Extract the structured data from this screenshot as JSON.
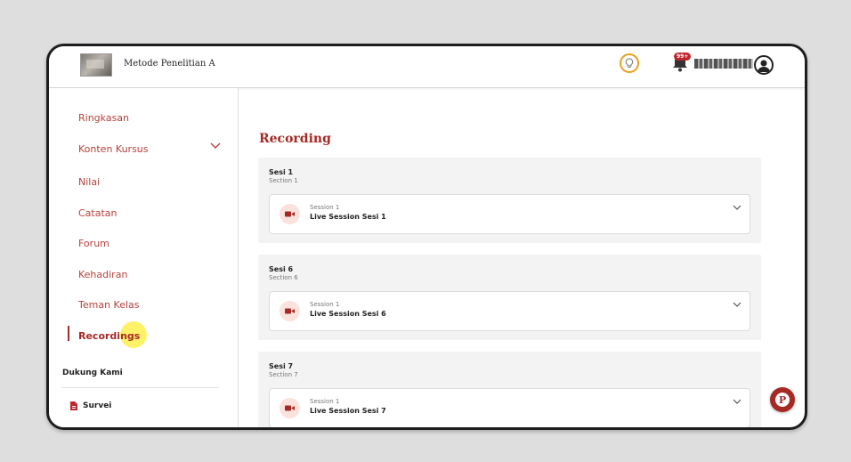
{
  "header": {
    "course_title": "Metode Penelitian A",
    "notification_count": "99+",
    "icons": [
      "course-thumbnail",
      "lightbulb-icon",
      "bell-icon",
      "user-avatar-icon"
    ]
  },
  "sidebar": {
    "items": [
      {
        "label": "Ringkasan"
      },
      {
        "label": "Konten Kursus"
      },
      {
        "label": "Nilai"
      },
      {
        "label": "Catatan"
      },
      {
        "label": "Forum"
      },
      {
        "label": "Kehadiran"
      },
      {
        "label": "Teman Kelas"
      },
      {
        "label": "Recordings",
        "active": true
      }
    ],
    "support_heading": "Dukung Kami",
    "support_items": [
      {
        "label": "Survei"
      }
    ]
  },
  "main": {
    "title": "Recording",
    "sections": [
      {
        "name": "Sesi 1",
        "subtitle": "Section 1",
        "session_label": "Session 1",
        "session_title": "Live Session Sesi 1"
      },
      {
        "name": "Sesi 6",
        "subtitle": "Section 6",
        "session_label": "Session 1",
        "session_title": "Live Session Sesi 6"
      },
      {
        "name": "Sesi 7",
        "subtitle": "Section 7",
        "session_label": "Session 1",
        "session_title": "Live Session Sesi 7"
      }
    ]
  },
  "fab": {
    "letter": "P"
  },
  "colors": {
    "accent": "#a52a24",
    "badge": "#c0262d",
    "bulb": "#e9a01c",
    "section_bg": "#f3f3f3",
    "icon_bg": "#fbe2dc"
  }
}
